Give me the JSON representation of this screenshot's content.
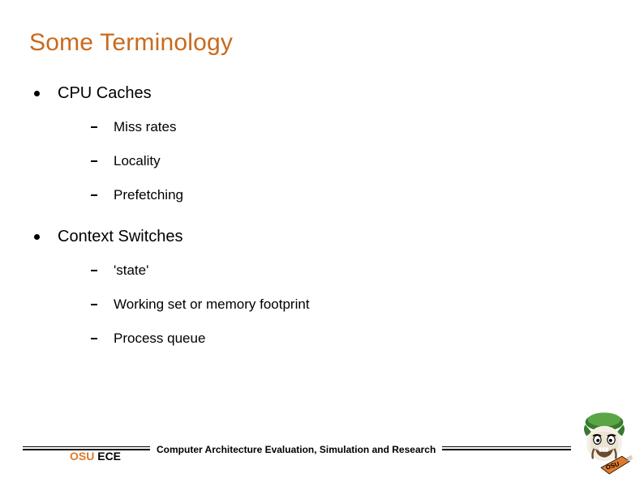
{
  "title": "Some Terminology",
  "items": [
    {
      "label": "CPU Caches",
      "sub": [
        "Miss rates",
        "Locality",
        "Prefetching"
      ]
    },
    {
      "label": "Context Switches",
      "sub": [
        "'state'",
        "Working set or memory footprint",
        "Process queue"
      ]
    }
  ],
  "footer": {
    "osu": "OSU",
    "ece": " ECE",
    "caption": "Computer Architecture Evaluation, Simulation and Research"
  }
}
